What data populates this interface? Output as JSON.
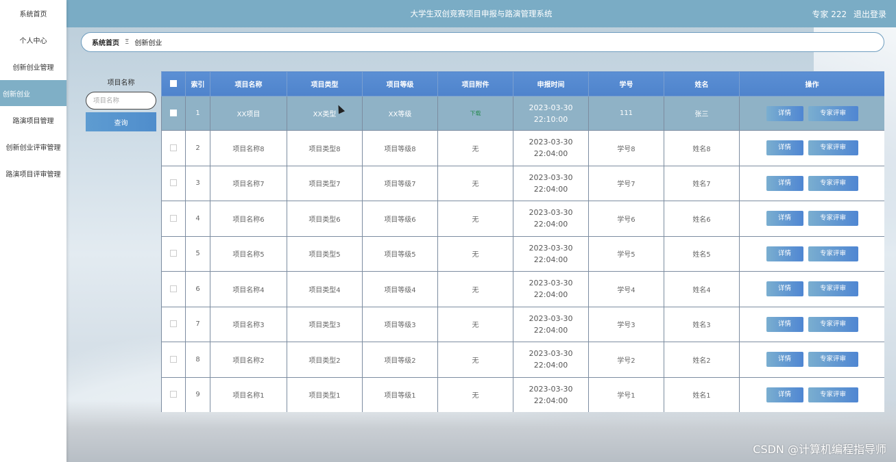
{
  "sidebar": {
    "items": [
      {
        "label": "系统首页"
      },
      {
        "label": "个人中心"
      },
      {
        "label": "创新创业管理"
      },
      {
        "label": "创新创业"
      },
      {
        "label": "路演项目管理"
      },
      {
        "label": "创新创业评审管理"
      },
      {
        "label": "路演项目评审管理"
      }
    ],
    "active_index": 3
  },
  "header": {
    "title": "大学生双创竞赛项目申报与路演管理系统",
    "user": "专家 222",
    "logout": "退出登录"
  },
  "breadcrumb": {
    "home": "系统首页",
    "separator": "Ξ",
    "current": "创新创业"
  },
  "search": {
    "label": "项目名称",
    "placeholder": "项目名称",
    "button": "查询"
  },
  "table": {
    "headers": [
      "索引",
      "项目名称",
      "项目类型",
      "项目等级",
      "项目附件",
      "申报时间",
      "学号",
      "姓名",
      "操作"
    ],
    "rows": [
      {
        "index": "1",
        "name": "XX项目",
        "type": "XX类型",
        "level": "XX等级",
        "attachment": "下载",
        "time": "2023-03-30 22:10:00",
        "student_id": "111",
        "student_name": "张三"
      },
      {
        "index": "2",
        "name": "项目名称8",
        "type": "项目类型8",
        "level": "项目等级8",
        "attachment": "无",
        "time": "2023-03-30 22:04:00",
        "student_id": "学号8",
        "student_name": "姓名8"
      },
      {
        "index": "3",
        "name": "项目名称7",
        "type": "项目类型7",
        "level": "项目等级7",
        "attachment": "无",
        "time": "2023-03-30 22:04:00",
        "student_id": "学号7",
        "student_name": "姓名7"
      },
      {
        "index": "4",
        "name": "项目名称6",
        "type": "项目类型6",
        "level": "项目等级6",
        "attachment": "无",
        "time": "2023-03-30 22:04:00",
        "student_id": "学号6",
        "student_name": "姓名6"
      },
      {
        "index": "5",
        "name": "项目名称5",
        "type": "项目类型5",
        "level": "项目等级5",
        "attachment": "无",
        "time": "2023-03-30 22:04:00",
        "student_id": "学号5",
        "student_name": "姓名5"
      },
      {
        "index": "6",
        "name": "项目名称4",
        "type": "项目类型4",
        "level": "项目等级4",
        "attachment": "无",
        "time": "2023-03-30 22:04:00",
        "student_id": "学号4",
        "student_name": "姓名4"
      },
      {
        "index": "7",
        "name": "项目名称3",
        "type": "项目类型3",
        "level": "项目等级3",
        "attachment": "无",
        "time": "2023-03-30 22:04:00",
        "student_id": "学号3",
        "student_name": "姓名3"
      },
      {
        "index": "8",
        "name": "项目名称2",
        "type": "项目类型2",
        "level": "项目等级2",
        "attachment": "无",
        "time": "2023-03-30 22:04:00",
        "student_id": "学号2",
        "student_name": "姓名2"
      },
      {
        "index": "9",
        "name": "项目名称1",
        "type": "项目类型1",
        "level": "项目等级1",
        "attachment": "无",
        "time": "2023-03-30 22:04:00",
        "student_id": "学号1",
        "student_name": "姓名1"
      }
    ],
    "actions": {
      "detail": "详情",
      "review": "专家评审"
    }
  },
  "watermark": "CSDN @计算机编程指导师",
  "colors": {
    "header": "#7aacc5",
    "active_sidebar": "#7fafc6",
    "table_header": "#5b8fd4",
    "button": "#4f86d2"
  }
}
